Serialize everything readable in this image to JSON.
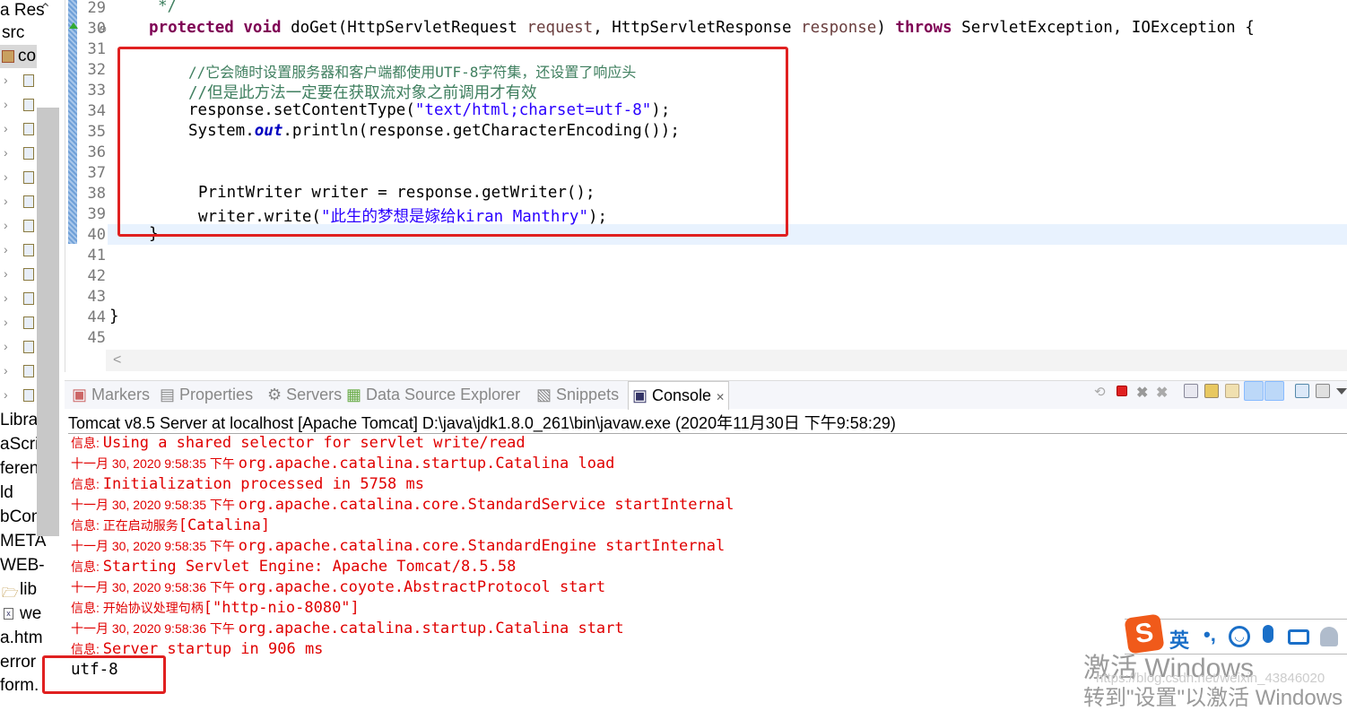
{
  "sidebar": {
    "items": [
      "a Res",
      "src",
      "co",
      "Libra",
      "aScri",
      "feren",
      "ld",
      "bCon",
      "META",
      "WEB-",
      "lib",
      "we",
      "a.htm",
      "error",
      "form."
    ]
  },
  "editor": {
    "line_numbers": [
      "29",
      "30",
      "31",
      "32",
      "33",
      "34",
      "35",
      "36",
      "37",
      "38",
      "39",
      "40",
      "41",
      "42",
      "43",
      "44",
      "45"
    ],
    "lines": {
      "l29": "*/",
      "l30_kw1": "protected",
      "l30_kw2": "void",
      "l30_a": " doGet(HttpServletRequest ",
      "l30_p1": "request",
      "l30_b": ", HttpServletResponse ",
      "l30_p2": "response",
      "l30_c": ") ",
      "l30_kw3": "throws",
      "l30_d": " ServletException, IOException {",
      "l32": "//它会随时设置服务器和客户端都使用UTF-8字符集，还设置了响应头",
      "l33": "//但是此方法一定要在获取流对象之前调用才有效",
      "l34_a": "response.setContentType(",
      "l34_s": "\"text/html;charset=utf-8\"",
      "l34_b": ");",
      "l35_a": "System.",
      "l35_f": "out",
      "l35_b": ".println(response.getCharacterEncoding());",
      "l38": "PrintWriter writer = response.getWriter();",
      "l39_a": "writer.write(",
      "l39_s": "\"此生的梦想是嫁给kiran Manthry\"",
      "l39_b": ");",
      "l40": "}",
      "l44": "}"
    }
  },
  "panel": {
    "tabs": [
      {
        "label": "Markers",
        "icon": "markers-icon"
      },
      {
        "label": "Properties",
        "icon": "properties-icon"
      },
      {
        "label": "Servers",
        "icon": "servers-icon"
      },
      {
        "label": "Data Source Explorer",
        "icon": "data-source-icon"
      },
      {
        "label": "Snippets",
        "icon": "snippets-icon"
      },
      {
        "label": "Console",
        "icon": "console-icon",
        "active": true
      }
    ],
    "close_glyph": "✕"
  },
  "console": {
    "title": "Tomcat v8.5 Server at localhost [Apache Tomcat] D:\\java\\jdk1.8.0_261\\bin\\javaw.exe (2020年11月30日 下午9:58:29)",
    "lines": [
      {
        "pre": "信息: ",
        "msg": "Using a shared selector for servlet write/read"
      },
      {
        "pre": "十一月 30, 2020 9:58:35 下午 ",
        "msg": "org.apache.catalina.startup.Catalina load"
      },
      {
        "pre": "信息: ",
        "msg": "Initialization processed in 5758 ms"
      },
      {
        "pre": "十一月 30, 2020 9:58:35 下午 ",
        "msg": "org.apache.catalina.core.StandardService startInternal"
      },
      {
        "pre": "信息: 正在启动服务",
        "msg": "[Catalina]"
      },
      {
        "pre": "十一月 30, 2020 9:58:35 下午 ",
        "msg": "org.apache.catalina.core.StandardEngine startInternal"
      },
      {
        "pre": "信息: ",
        "msg": "Starting Servlet Engine: Apache Tomcat/8.5.58"
      },
      {
        "pre": "十一月 30, 2020 9:58:36 下午 ",
        "msg": "org.apache.coyote.AbstractProtocol start"
      },
      {
        "pre": "信息: 开始协议处理句柄",
        "msg": "[\"http-nio-8080\"]"
      },
      {
        "pre": "十一月 30, 2020 9:58:36 下午 ",
        "msg": "org.apache.catalina.startup.Catalina start"
      },
      {
        "pre": "信息: ",
        "msg": "Server startup in 906 ms"
      }
    ],
    "output": "utf-8"
  },
  "ime": {
    "mode": "英",
    "punct": "•,"
  },
  "watermark": {
    "activate": "激活 Windows",
    "goto": "转到\"设置\"以激活 Windows",
    "url": "https://blog.csdn.net/weixin_43846020"
  },
  "colors": {
    "highlight_box": "#e02020",
    "console_error": "#e00000",
    "keyword": "#7f0055",
    "comment": "#3f7f5f",
    "string": "#2a00ff"
  }
}
